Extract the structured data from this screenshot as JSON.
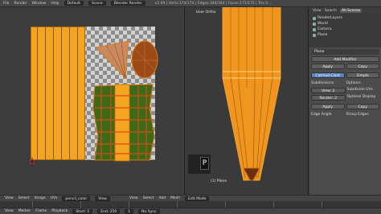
{
  "top_bar": {
    "menus": [
      "File",
      "Render",
      "Window",
      "Help"
    ],
    "layout": "Default",
    "scene": "Scene",
    "engine": "Blender Render",
    "stats": "v2.69 | Verts:174/174 | Edges:344/344 | Faces:172/172 | Tris:3..."
  },
  "viewport": {
    "view_label": "User Ortho",
    "object_label": "(1) Plane",
    "tool_letter": "P"
  },
  "properties": {
    "tabs": [
      "View",
      "Search",
      "All Scenes"
    ],
    "outliner_items": [
      "RenderLayers",
      "World",
      "Camera",
      "Plane"
    ],
    "object_name": "Plane",
    "add_modifier": "Add Modifier",
    "apply": "Apply",
    "copy": "Copy",
    "catmull": "Catmull-Clark",
    "simple": "Simple",
    "subdivisions": "Subdivisions:",
    "options": "Options:",
    "view": "View: 2",
    "render": "Render: 2",
    "subdiv_uvs": "Subdivide UVs",
    "optimal_display": "Optimal Display",
    "edge_angle": "Edge Angle",
    "sharp_edges": "Sharp Edges"
  },
  "uv_bar": {
    "items": [
      "View",
      "Select",
      "Image",
      "UVs"
    ],
    "image_name": "pencil_color",
    "view_btn": "View"
  },
  "view3d_bar": {
    "items": [
      "View",
      "Select",
      "Add",
      "Mesh"
    ],
    "mode": "Edit Mode"
  },
  "timeline_bar": {
    "items": [
      "View",
      "Marker",
      "Frame",
      "Playback"
    ],
    "start": "Start: 1",
    "end": "End: 250",
    "frame": "1",
    "sync": "No Sync"
  }
}
